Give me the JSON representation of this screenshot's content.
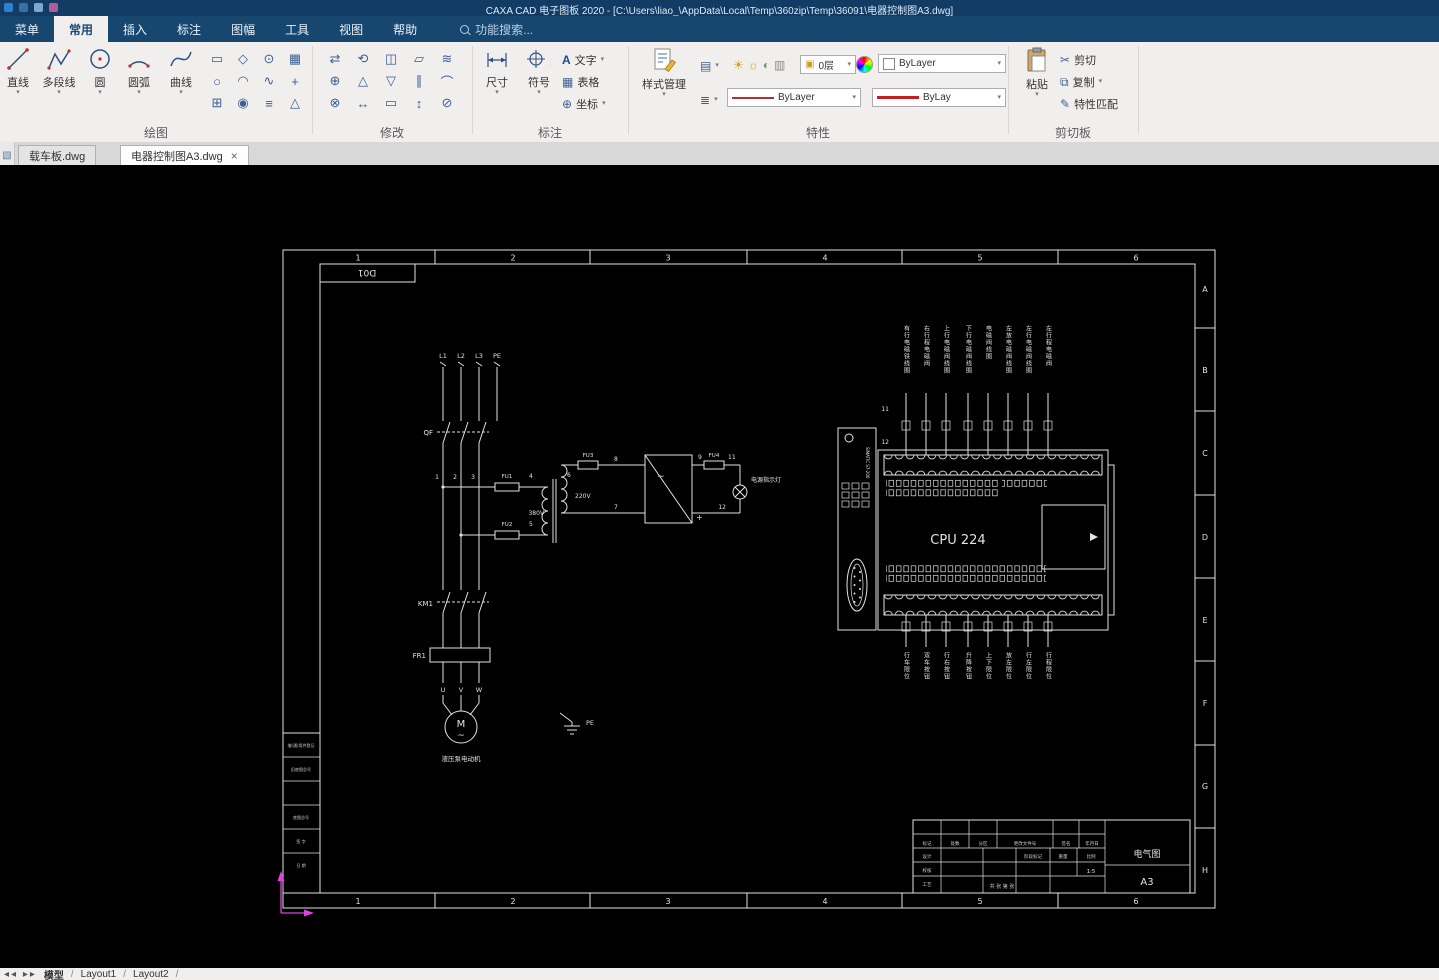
{
  "window": {
    "title": "CAXA CAD 电子图板 2020 - [C:\\Users\\liao_\\AppData\\Local\\Temp\\360zip\\Temp\\36091\\电器控制图A3.dwg]"
  },
  "menu": {
    "items": [
      "菜单",
      "常用",
      "插入",
      "标注",
      "图幅",
      "工具",
      "视图",
      "帮助"
    ],
    "search": "功能搜索..."
  },
  "ribbon": {
    "groups": [
      "绘图",
      "修改",
      "标注",
      "特性",
      "剪切板"
    ],
    "draw": {
      "line": "直线",
      "polyline": "多段线",
      "circle": "圆",
      "arc": "圆弧",
      "curve": "曲线"
    },
    "draw_icons": [
      "▭",
      "◇",
      "⊙",
      "▦",
      "○",
      "◠",
      "∿",
      "+",
      "⊞",
      "◉",
      "≡",
      "△"
    ],
    "modify_icons": [
      "⇄",
      "⟲",
      "◫",
      "▱",
      "≋",
      "⊕",
      "△",
      "▽",
      "∥",
      "⌒",
      "⊗",
      "↔",
      "▭",
      "↕",
      "⊘"
    ],
    "annotate": {
      "dim": "尺寸",
      "sym": "符号",
      "text": "文字",
      "table": "表格",
      "coord": "坐标"
    },
    "annotate_icons": {
      "text": "A",
      "table": "▦",
      "coord": "⊕"
    },
    "props": {
      "style": "样式管理",
      "layer": "0层",
      "color": "ByLayer",
      "linetype": "ByLayer",
      "lineweight": "ByLay"
    },
    "clip": {
      "paste": "粘贴",
      "cut": "剪切",
      "copy": "复制",
      "match": "特性匹配"
    },
    "clip_icons": {
      "cut": "✂",
      "copy": "⧉",
      "match": "✎"
    }
  },
  "doc_tabs": [
    {
      "label": "载车板.dwg"
    },
    {
      "label": "电器控制图A3.dwg"
    }
  ],
  "statusbar": {
    "tabs": [
      "模型",
      "Layout1",
      "Layout2"
    ]
  },
  "drawing": {
    "zones_h": [
      "1",
      "2",
      "3",
      "4",
      "5",
      "6"
    ],
    "zones_v": [
      "A",
      "B",
      "C",
      "D",
      "E",
      "F",
      "G",
      "H"
    ],
    "labels": {
      "d01": "D01",
      "L1": "L1",
      "L2": "L2",
      "L3": "L3",
      "PE": "PE",
      "QF": "QF",
      "KM1": "KM1",
      "FR1": "FR1",
      "n1": "1",
      "n2": "2",
      "n3": "3",
      "n4": "4",
      "n5": "5",
      "n6": "6",
      "n7": "7",
      "n8": "8",
      "n9": "9",
      "n11": "11",
      "n12": "12",
      "FU1": "FU1",
      "FU2": "FU2",
      "FU3": "FU3",
      "FU4": "FU4",
      "v380": "380V",
      "v220": "220V",
      "lamp": "电源指示灯",
      "U": "U",
      "V": "V",
      "W": "W",
      "M": "M",
      "tilde": "~",
      "motor": "液压泵电动机",
      "PE2": "PE",
      "cpu": "CPU 224",
      "p11": "11",
      "p12": "12",
      "brand": "SIMATIC S7-200"
    },
    "plc_top_labels": [
      "有行电磁铁线圈",
      "右行程电磁阀",
      "上行电磁阀线圈",
      "下行电磁阀线圈",
      "电磁阀线圈",
      "左放电磁阀线圈",
      "左行电磁阀线圈",
      "左行程电磁阀"
    ],
    "plc_bottom_labels": [
      "行车限位",
      "双车按钮",
      "行右按钮",
      "升降按钮",
      "上下限位",
      "放左限位",
      "行左限位",
      "行程限位"
    ],
    "left_cells": [
      "借(通)用件登记",
      "旧底图总号",
      "底图总号",
      "签 字",
      "日 期"
    ],
    "titleblock": {
      "f1": "标记",
      "f2": "处数",
      "f3": "分区",
      "f4": "更改文件号",
      "f5": "签名",
      "f6": "年月日",
      "design": "设计",
      "check": "校核",
      "craft": "工艺",
      "stage": "阶段标记",
      "weight": "重量",
      "scale_label": "比例",
      "scale": "1:5",
      "sheet": "共 张 第 张",
      "name": "电气图",
      "size": "A3"
    }
  }
}
